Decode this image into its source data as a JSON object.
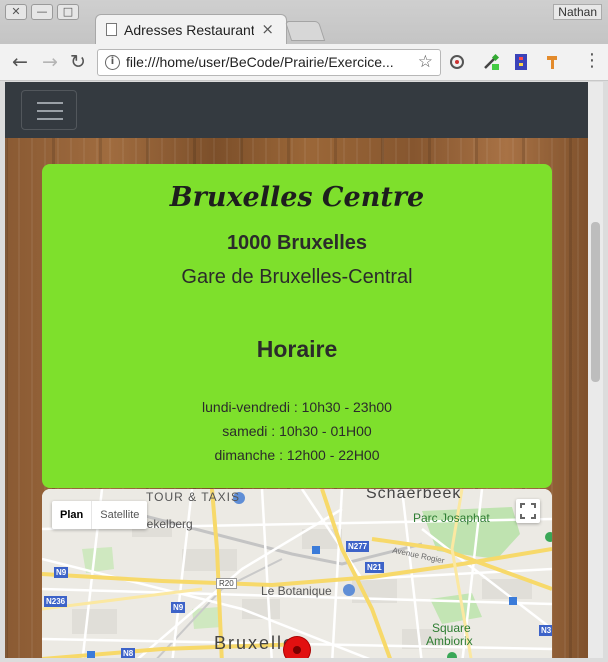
{
  "window": {
    "user": "Nathan",
    "tab_title": "Adresses Restaurant",
    "tab_close": "×"
  },
  "toolbar": {
    "back": "←",
    "forward": "→",
    "reload": "↻",
    "url": "file:///home/user/BeCode/Prairie/Exercice...",
    "star": "☆",
    "menu": "⋮"
  },
  "restaurant": {
    "name": "Bruxelles Centre",
    "city": "1000 Bruxelles",
    "station": "Gare de Bruxelles-Central",
    "hours_title": "Horaire",
    "hours": [
      "lundi-vendredi : 10h30 - 23h00",
      "samedi : 10h30 - 01H00",
      "dimanche : 12h00 - 22H00"
    ]
  },
  "map": {
    "type_plan": "Plan",
    "type_satellite": "Satellite",
    "labels": {
      "tour_taxis": "TOUR & TAXIS",
      "schaerbeek": "Schaerbeek",
      "koekelberg": "Koekelberg",
      "parc": "Parc Josaphat",
      "avenue": "Avenue Rogier",
      "botanique": "Le Botanique",
      "bruxelles": "Bruxelles",
      "square1": "Square",
      "square2": "Ambiorix"
    },
    "shields": [
      "N277",
      "N21",
      "N9",
      "R20",
      "N9",
      "N236",
      "N8",
      "N3",
      "R"
    ]
  },
  "colors": {
    "card_green": "#7ee02c",
    "navbar": "#343a40",
    "marker": "#e21010"
  }
}
